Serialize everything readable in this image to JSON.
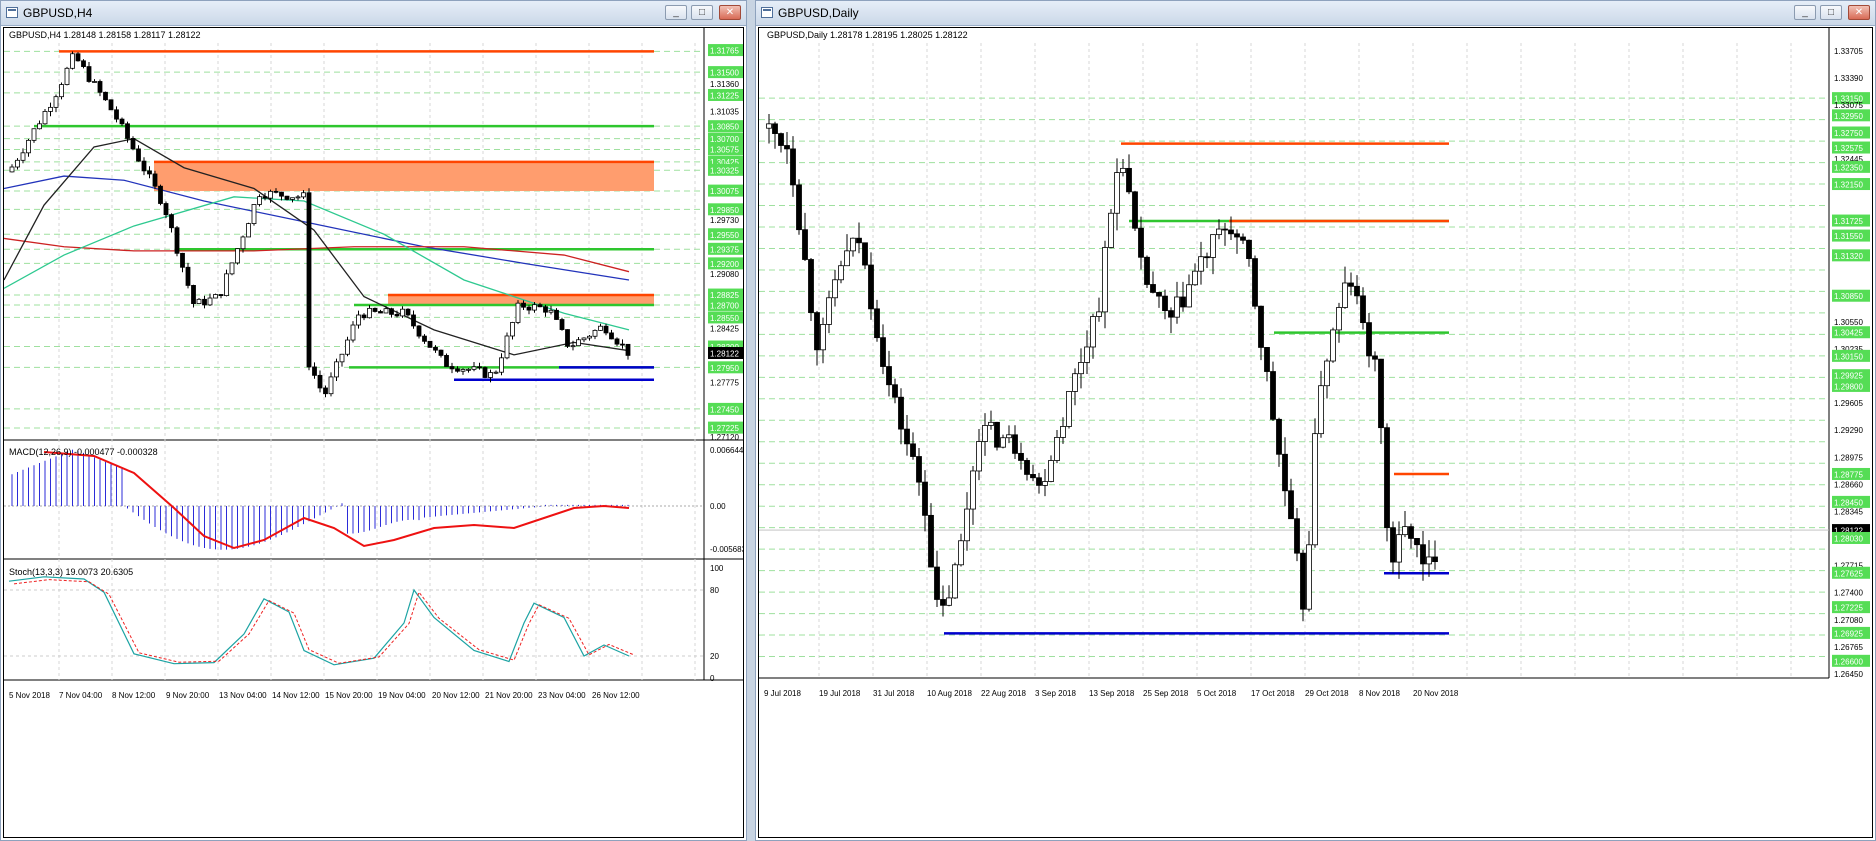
{
  "left_window": {
    "title": "GBPUSD,H4",
    "header": "GBPUSD,H4  1.28148 1.28158 1.28117 1.28122",
    "price_labels": [
      "1.31765",
      "1.31500",
      "1.31360",
      "1.31225",
      "1.31035",
      "1.30850",
      "1.30700",
      "1.30575",
      "1.30425",
      "1.30325",
      "1.30075",
      "1.29850",
      "1.29730",
      "1.29550",
      "1.29375",
      "1.29200",
      "1.29080",
      "1.28825",
      "1.28700",
      "1.28550",
      "1.28425",
      "1.28200",
      "1.28122",
      "1.27950",
      "1.27775",
      "1.27450",
      "1.27225",
      "1.27120"
    ],
    "macd_label": "MACD(12,26,9) -0.000477 -0.000328",
    "macd_scale": [
      "0.006644",
      "0.00",
      "-0.005683"
    ],
    "stoch_label": "Stoch(13,3,3) 19.0073 20.6305",
    "stoch_scale": [
      "100",
      "80",
      "20",
      "0"
    ],
    "time_labels": [
      "5 Nov 2018",
      "7 Nov 04:00",
      "8 Nov 12:00",
      "9 Nov 20:00",
      "13 Nov 04:00",
      "14 Nov 12:00",
      "15 Nov 20:00",
      "19 Nov 04:00",
      "20 Nov 12:00",
      "21 Nov 20:00",
      "23 Nov 04:00",
      "26 Nov 12:00"
    ],
    "current_price": "1.28122"
  },
  "right_window": {
    "title": "GBPUSD,Daily",
    "header": "GBPUSD,Daily  1.28178 1.28195 1.28025 1.28122",
    "price_labels": [
      "1.33705",
      "1.33390",
      "1.33150",
      "1.32950",
      "1.33075",
      "1.32750",
      "1.32575",
      "1.32445",
      "1.32350",
      "1.32150",
      "1.31725",
      "1.31550",
      "1.31320",
      "1.30850",
      "1.30550",
      "1.30425",
      "1.30235",
      "1.30150",
      "1.29925",
      "1.29800",
      "1.29605",
      "1.29290",
      "1.28975",
      "1.28775",
      "1.28660",
      "1.28450",
      "1.28345",
      "1.28122",
      "1.28030",
      "1.27715",
      "1.27625",
      "1.27400",
      "1.27225",
      "1.27080",
      "1.26925",
      "1.26765",
      "1.26600",
      "1.26450"
    ],
    "time_labels": [
      "9 Jul 2018",
      "19 Jul 2018",
      "31 Jul 2018",
      "10 Aug 2018",
      "22 Aug 2018",
      "3 Sep 2018",
      "13 Sep 2018",
      "25 Sep 2018",
      "5 Oct 2018",
      "17 Oct 2018",
      "29 Oct 2018",
      "8 Nov 2018",
      "20 Nov 2018"
    ],
    "current_price": "1.28122"
  },
  "buttons": {
    "minimize": "_",
    "maximize": "□",
    "close": "✕"
  },
  "colors": {
    "green": "#2ec62e",
    "red": "#ff4500",
    "blue": "#0000cc",
    "zone": "#ff9d6e",
    "grid": "#c8d6c8"
  }
}
